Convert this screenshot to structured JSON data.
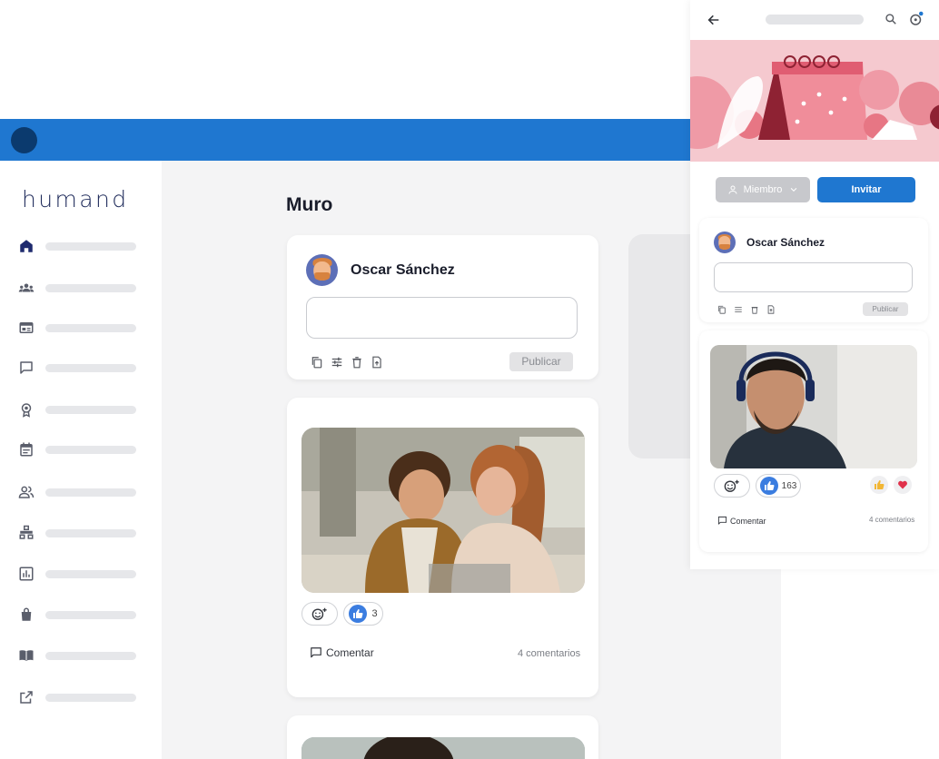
{
  "app": {
    "logo_text": "humand",
    "brand_color": "#1f77d0"
  },
  "sidebar": {
    "items": [
      {
        "icon": "home-icon"
      },
      {
        "icon": "groups-icon"
      },
      {
        "icon": "news-icon"
      },
      {
        "icon": "chat-icon"
      },
      {
        "icon": "badge-icon"
      },
      {
        "icon": "calendar-icon"
      },
      {
        "icon": "people-icon"
      },
      {
        "icon": "org-chart-icon"
      },
      {
        "icon": "stats-icon"
      },
      {
        "icon": "bag-icon"
      },
      {
        "icon": "book-icon"
      },
      {
        "icon": "external-link-icon"
      }
    ]
  },
  "main": {
    "title": "Muro",
    "composer": {
      "author": "Oscar Sánchez",
      "publish_label": "Publicar"
    },
    "post": {
      "reaction_count": "3",
      "comment_label": "Comentar",
      "comment_count": "4 comentarios"
    }
  },
  "mobile": {
    "member_label": "Miembro",
    "invite_label": "Invitar",
    "composer": {
      "author": "Oscar Sánchez",
      "publish_label": "Publicar"
    },
    "post": {
      "reaction_count": "163",
      "comment_label": "Comentar",
      "comment_count": "4 comentarios"
    }
  }
}
